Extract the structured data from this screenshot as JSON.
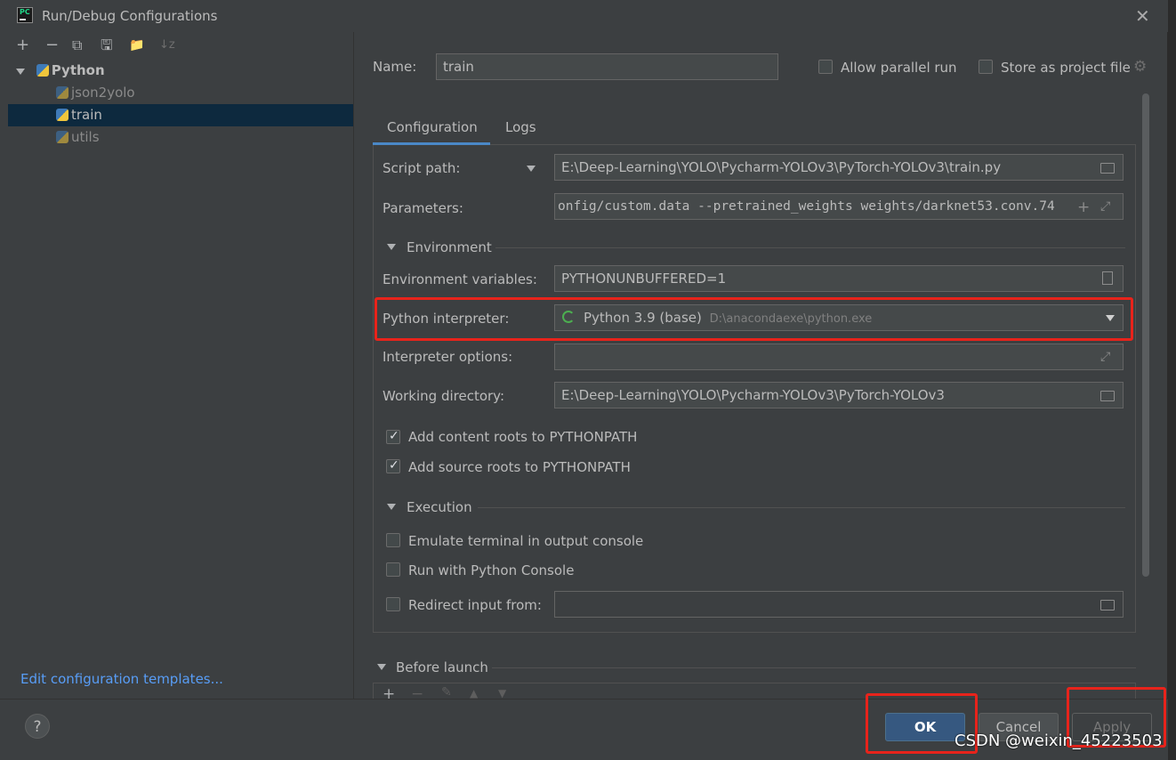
{
  "window": {
    "title": "Run/Debug Configurations",
    "app_icon_text": "PC",
    "close_glyph": "✕"
  },
  "toolbar": {
    "add": "+",
    "remove": "−",
    "copy": "⧉",
    "save": "🖫",
    "new_folder": "📁",
    "sort": "↓z"
  },
  "tree": {
    "root": "Python",
    "items": [
      "json2yolo",
      "train",
      "utils"
    ],
    "selected": "train"
  },
  "edit_templates_link": "Edit configuration templates...",
  "header": {
    "name_label": "Name:",
    "name_value": "train",
    "allow_parallel_label": "Allow parallel run",
    "store_as_project_label": "Store as project file"
  },
  "tabs": [
    "Configuration",
    "Logs"
  ],
  "config": {
    "script_path_label": "Script path:",
    "script_path_value": "E:\\Deep-Learning\\YOLO\\Pycharm-YOLOv3\\PyTorch-YOLOv3\\train.py",
    "parameters_label": "Parameters:",
    "parameters_value": "onfig/custom.data --pretrained_weights weights/darknet53.conv.74",
    "environment_section": "Environment",
    "env_vars_label": "Environment variables:",
    "env_vars_value": "PYTHONUNBUFFERED=1",
    "interpreter_label": "Python interpreter:",
    "interpreter_name": "Python 3.9 (base)",
    "interpreter_path": "D:\\anacondaexe\\python.exe",
    "interpreter_options_label": "Interpreter options:",
    "interpreter_options_value": "",
    "working_dir_label": "Working directory:",
    "working_dir_value": "E:\\Deep-Learning\\YOLO\\Pycharm-YOLOv3\\PyTorch-YOLOv3",
    "add_content_roots": "Add content roots to PYTHONPATH",
    "add_source_roots": "Add source roots to PYTHONPATH",
    "execution_section": "Execution",
    "emulate_terminal": "Emulate terminal in output console",
    "run_with_console": "Run with Python Console",
    "redirect_input": "Redirect input from:",
    "redirect_input_value": ""
  },
  "before_launch": {
    "label": "Before launch",
    "toolbar": [
      "+",
      "−",
      "✎",
      "▲",
      "▼"
    ]
  },
  "footer": {
    "help": "?",
    "ok": "OK",
    "cancel": "Cancel",
    "apply": "Apply"
  },
  "watermark": "CSDN @weixin_45223503",
  "colors": {
    "accent_highlight": "#e8231b",
    "selection": "#0d293e",
    "link": "#589df6"
  }
}
